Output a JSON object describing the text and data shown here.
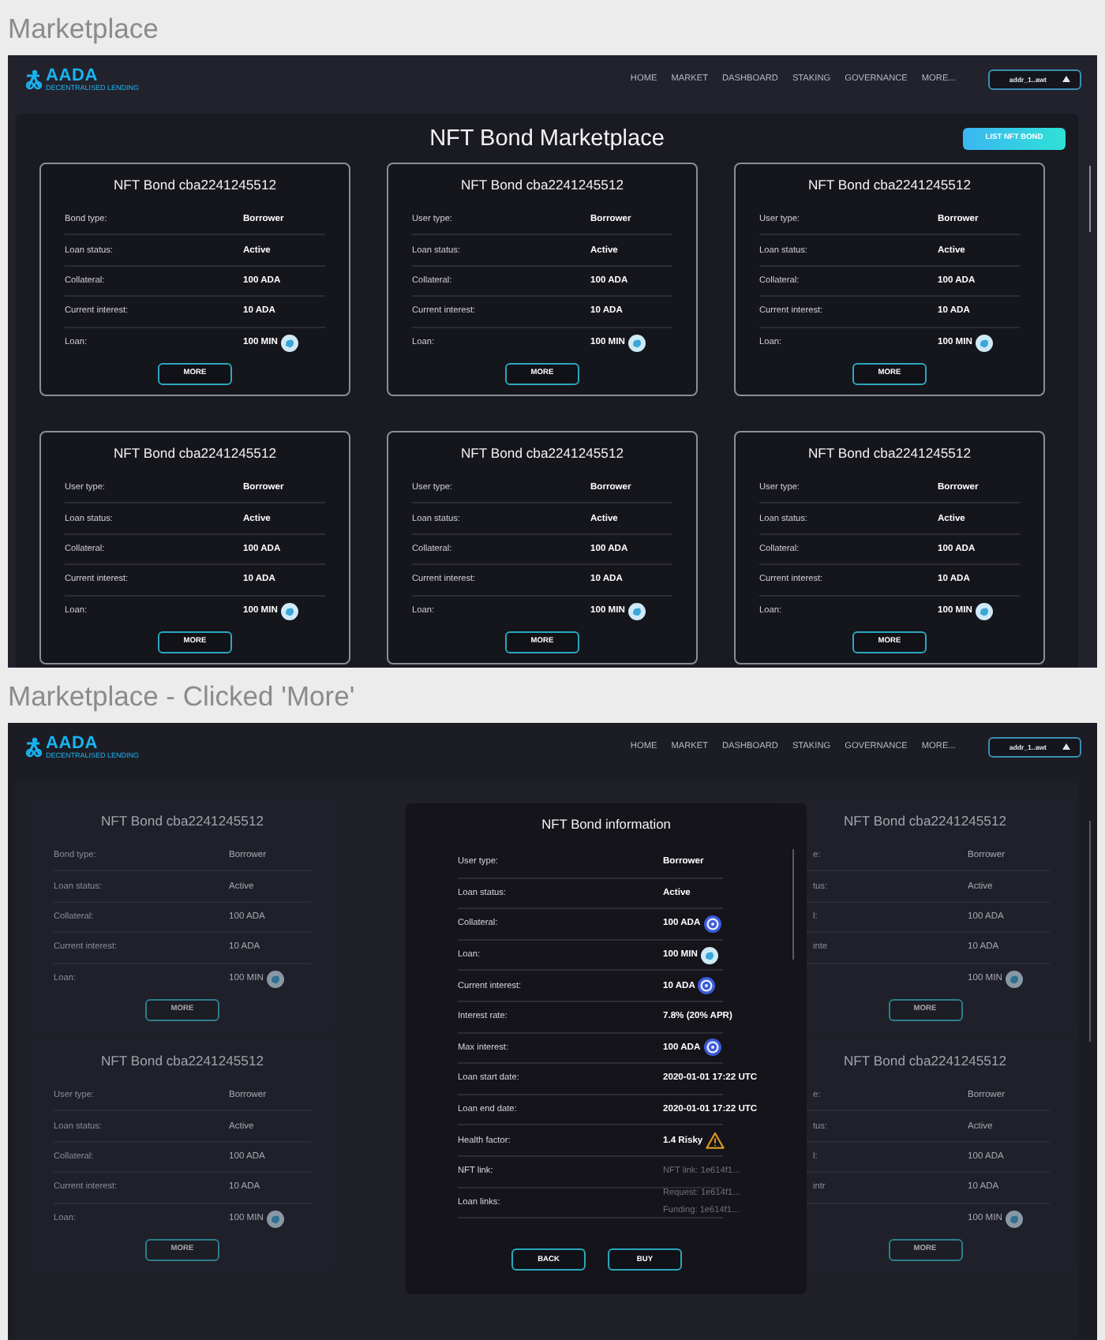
{
  "screens": [
    {
      "caption": "Marketplace",
      "dimmed": false,
      "nav": {
        "logo": "AADA",
        "tagline": "DECENTRALISED LENDING",
        "links": [
          "HOME",
          "MARKET",
          "DASHBOARD",
          "STAKING",
          "GOVERNANCE",
          "MORE..."
        ],
        "wallet": "addr_1..awt"
      },
      "title": "NFT Bond Marketplace",
      "action": "LIST NFT BOND",
      "cards": [
        {
          "title": "NFT Bond cba2241245512",
          "rows": [
            {
              "kind": "text",
              "label": "Bond type:",
              "value": "Borrower"
            },
            {
              "kind": "text",
              "label": "Loan status:",
              "value": "Active"
            },
            {
              "kind": "text",
              "label": "Collateral:",
              "value": "100 ADA"
            },
            {
              "kind": "text",
              "label": "Current interest:",
              "value": "10 ADA"
            },
            {
              "kind": "coin",
              "label": "Loan:",
              "value": "100 MIN"
            }
          ],
          "button": "MORE"
        },
        {
          "title": "NFT Bond cba2241245512",
          "rows": [
            {
              "kind": "text",
              "label": "User type:",
              "value": "Borrower"
            },
            {
              "kind": "text",
              "label": "Loan status:",
              "value": "Active"
            },
            {
              "kind": "text",
              "label": "Collateral:",
              "value": "100 ADA"
            },
            {
              "kind": "text",
              "label": "Current interest:",
              "value": "10 ADA"
            },
            {
              "kind": "coin",
              "label": "Loan:",
              "value": "100 MIN"
            }
          ],
          "button": "MORE"
        },
        {
          "title": "NFT Bond cba2241245512",
          "rows": [
            {
              "kind": "text",
              "label": "User type:",
              "value": "Borrower"
            },
            {
              "kind": "text",
              "label": "Loan status:",
              "value": "Active"
            },
            {
              "kind": "text",
              "label": "Collateral:",
              "value": "100 ADA"
            },
            {
              "kind": "text",
              "label": "Current interest:",
              "value": "10 ADA"
            },
            {
              "kind": "coin",
              "label": "Loan:",
              "value": "100 MIN"
            }
          ],
          "button": "MORE"
        },
        {
          "title": "NFT Bond cba2241245512",
          "rows": [
            {
              "kind": "text",
              "label": "User type:",
              "value": "Borrower"
            },
            {
              "kind": "text",
              "label": "Loan status:",
              "value": "Active"
            },
            {
              "kind": "text",
              "label": "Collateral:",
              "value": "100 ADA"
            },
            {
              "kind": "text",
              "label": "Current interest:",
              "value": "10 ADA"
            },
            {
              "kind": "coin",
              "label": "Loan:",
              "value": "100 MIN"
            }
          ],
          "button": "MORE"
        },
        {
          "title": "NFT Bond cba2241245512",
          "rows": [
            {
              "kind": "text",
              "label": "User type:",
              "value": "Borrower"
            },
            {
              "kind": "text",
              "label": "Loan status:",
              "value": "Active"
            },
            {
              "kind": "text",
              "label": "Collateral:",
              "value": "100 ADA"
            },
            {
              "kind": "text",
              "label": "Current interest:",
              "value": "10 ADA"
            },
            {
              "kind": "coin",
              "label": "Loan:",
              "value": "100 MIN"
            }
          ],
          "button": "MORE"
        },
        {
          "title": "NFT Bond cba2241245512",
          "rows": [
            {
              "kind": "text",
              "label": "User type:",
              "value": "Borrower"
            },
            {
              "kind": "text",
              "label": "Loan status:",
              "value": "Active"
            },
            {
              "kind": "text",
              "label": "Collateral:",
              "value": "100 ADA"
            },
            {
              "kind": "text",
              "label": "Current interest:",
              "value": "10 ADA"
            },
            {
              "kind": "coin",
              "label": "Loan:",
              "value": "100 MIN"
            }
          ],
          "button": "MORE"
        }
      ]
    },
    {
      "caption": "Marketplace - Clicked 'More'",
      "dimmed": true,
      "nav": {
        "logo": "AADA",
        "tagline": "DECENTRALISED LENDING",
        "links": [
          "HOME",
          "MARKET",
          "DASHBOARD",
          "STAKING",
          "GOVERNANCE",
          "MORE..."
        ],
        "wallet": "addr_1..awt"
      },
      "cards": [
        {
          "title": "NFT Bond cba2241245512",
          "rows": [
            {
              "kind": "text",
              "label": "Bond type:",
              "value": "Borrower"
            },
            {
              "kind": "text",
              "label": "Loan status:",
              "value": "Active"
            },
            {
              "kind": "text",
              "label": "Collateral:",
              "value": "100 ADA"
            },
            {
              "kind": "text",
              "label": "Current interest:",
              "value": "10 ADA"
            },
            {
              "kind": "coin",
              "label": "Loan:",
              "value": "100 MIN"
            }
          ],
          "button": "MORE"
        },
        {
          "title": "NFT Bond cba2241245512",
          "rows": [
            {
              "kind": "text",
              "label": "e:",
              "value": "Borrower"
            },
            {
              "kind": "text",
              "label": "tus:",
              "value": "Active"
            },
            {
              "kind": "text",
              "label": "l:",
              "value": "100 ADA"
            },
            {
              "kind": "text",
              "label": "inte",
              "value": "10 ADA"
            },
            {
              "kind": "coin",
              "value": "100 MIN"
            }
          ],
          "button": "MORE"
        },
        {
          "title": "NFT Bond cba2241245512",
          "rows": [
            {
              "kind": "text",
              "label": "User type:",
              "value": "Borrower"
            },
            {
              "kind": "text",
              "label": "Loan status:",
              "value": "Active"
            },
            {
              "kind": "text",
              "label": "Collateral:",
              "value": "100 ADA"
            },
            {
              "kind": "text",
              "label": "Current interest:",
              "value": "10 ADA"
            },
            {
              "kind": "coin",
              "label": "Loan:",
              "value": "100 MIN"
            }
          ],
          "button": "MORE"
        },
        {
          "title": "NFT Bond cba2241245512",
          "rows": [
            {
              "kind": "text",
              "label": "e:",
              "value": "Borrower"
            },
            {
              "kind": "text",
              "label": "tus:",
              "value": "Active"
            },
            {
              "kind": "text",
              "label": "l:",
              "value": "100 ADA"
            },
            {
              "kind": "text",
              "label": "intr",
              "value": "10 ADA"
            },
            {
              "kind": "coin",
              "value": "100 MIN"
            }
          ],
          "button": "MORE"
        }
      ],
      "modal": {
        "title": "NFT Bond information",
        "rows": [
          {
            "kind": "text",
            "label": "User type:",
            "value": [
              "Borrower"
            ]
          },
          {
            "kind": "text",
            "label": "Loan status:",
            "value": [
              "Active"
            ]
          },
          {
            "kind": "ring_coin",
            "label": "Collateral:",
            "value": [
              "100 ADA"
            ]
          },
          {
            "kind": "coin",
            "label": "Loan:",
            "value": [
              "100 MIN"
            ]
          },
          {
            "kind": "ring_coin",
            "label": "Current interest:",
            "value": [
              "10 ADA"
            ]
          },
          {
            "kind": "text",
            "label": "Interest rate:",
            "value": [
              "7.8% (20% APR)"
            ]
          },
          {
            "kind": "ring_coin",
            "label": "Max interest:",
            "value": [
              "100 ADA"
            ]
          },
          {
            "kind": "text",
            "label": "Loan start date:",
            "value": [
              "2020-01-01 17:22 UTC"
            ]
          },
          {
            "kind": "text",
            "label": "Loan end date:",
            "value": [
              "2020-01-01 17:22 UTC"
            ]
          },
          {
            "kind": "warning",
            "label": "Health factor:",
            "value": [
              "1.4 Risky"
            ]
          },
          {
            "kind": "links",
            "label": "NFT link:",
            "value": [
              "NFT link: 1e614f1..."
            ]
          },
          {
            "kind": "links",
            "label": "Loan links:",
            "value": [
              "Request: 1e614f1...",
              "Funding: 1e614f1..."
            ]
          }
        ],
        "buttons": [
          "BACK",
          "BUY"
        ]
      }
    }
  ]
}
